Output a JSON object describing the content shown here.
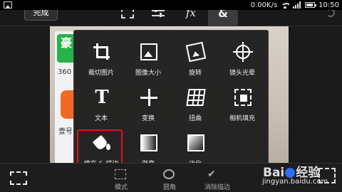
{
  "status_bar": {
    "speed": "0.00K/s",
    "time": "10:50"
  },
  "toolbar": {
    "done_label": "完成",
    "fx_label": "fx",
    "amp_label": "&"
  },
  "background": {
    "app1_text": "豪",
    "app1_label": "360",
    "app2_label": "壹号"
  },
  "menu": {
    "items": [
      {
        "label": "裁切图片",
        "icon": "crop-icon"
      },
      {
        "label": "图像大小",
        "icon": "image-size-icon"
      },
      {
        "label": "旋转",
        "icon": "rotate-icon"
      },
      {
        "label": "镜头光晕",
        "icon": "lens-flare-icon"
      },
      {
        "label": "文本",
        "icon": "text-icon",
        "glyph": "T"
      },
      {
        "label": "变换",
        "icon": "transform-icon"
      },
      {
        "label": "扭曲",
        "icon": "warp-icon"
      },
      {
        "label": "相机填充",
        "icon": "camera-fill-icon"
      },
      {
        "label": "填充 & 描边",
        "icon": "fill-stroke-icon"
      },
      {
        "label": "渐变",
        "icon": "gradient-icon"
      },
      {
        "label": "淡化",
        "icon": "fade-icon"
      }
    ],
    "highlighted": "填充 & 描边",
    "highlight_color": "#e0141e"
  },
  "bottom_bar": {
    "mode_label": "模式",
    "round_label": "圆角",
    "erase_label": "消除描边"
  },
  "watermark": {
    "logo_a": "Bai",
    "logo_b": "经验",
    "url": "jingyan.baidu.com"
  }
}
